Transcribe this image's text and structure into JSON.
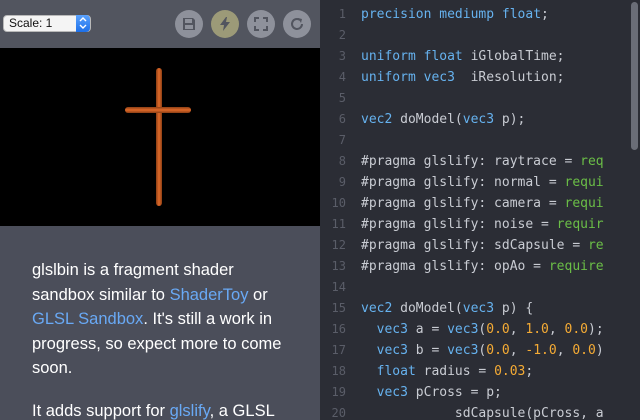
{
  "toolbar": {
    "scale_label": "Scale: 1",
    "buttons": [
      {
        "name": "save-icon"
      },
      {
        "name": "lightning-icon"
      },
      {
        "name": "fullscreen-icon"
      },
      {
        "name": "refresh-icon"
      }
    ]
  },
  "intro": {
    "p1": [
      {
        "text": "glslbin is a fragment shader sandbox similar to ",
        "link": false
      },
      {
        "text": "ShaderToy",
        "link": true
      },
      {
        "text": " or ",
        "link": false
      },
      {
        "text": "GLSL Sandbox",
        "link": true
      },
      {
        "text": ". It's still a work in progress, so expect more to come soon.",
        "link": false
      }
    ],
    "p2": [
      {
        "text": "It adds support for ",
        "link": false
      },
      {
        "text": "glslify",
        "link": true
      },
      {
        "text": ", a GLSL",
        "link": false
      }
    ]
  },
  "code": [
    {
      "n": "1",
      "parts": [
        [
          "kw",
          "precision"
        ],
        [
          "t",
          " "
        ],
        [
          "kw",
          "mediump"
        ],
        [
          "t",
          " "
        ],
        [
          "kw",
          "float"
        ],
        [
          "t",
          ";"
        ]
      ]
    },
    {
      "n": "2",
      "parts": []
    },
    {
      "n": "3",
      "parts": [
        [
          "kw",
          "uniform"
        ],
        [
          "t",
          " "
        ],
        [
          "kw",
          "float"
        ],
        [
          "t",
          " iGlobalTime;"
        ]
      ]
    },
    {
      "n": "4",
      "parts": [
        [
          "kw",
          "uniform"
        ],
        [
          "t",
          " "
        ],
        [
          "kw",
          "vec3"
        ],
        [
          "t",
          "  iResolution;"
        ]
      ]
    },
    {
      "n": "5",
      "parts": []
    },
    {
      "n": "6",
      "parts": [
        [
          "kw",
          "vec2"
        ],
        [
          "t",
          " doModel("
        ],
        [
          "kw",
          "vec3"
        ],
        [
          "t",
          " p);"
        ]
      ]
    },
    {
      "n": "7",
      "parts": []
    },
    {
      "n": "8",
      "parts": [
        [
          "t",
          "#pragma glslify: raytrace = "
        ],
        [
          "str",
          "req"
        ]
      ]
    },
    {
      "n": "9",
      "parts": [
        [
          "t",
          "#pragma glslify: normal = "
        ],
        [
          "str",
          "requi"
        ]
      ]
    },
    {
      "n": "10",
      "parts": [
        [
          "t",
          "#pragma glslify: camera = "
        ],
        [
          "str",
          "requi"
        ]
      ]
    },
    {
      "n": "11",
      "parts": [
        [
          "t",
          "#pragma glslify: noise = "
        ],
        [
          "str",
          "requir"
        ]
      ]
    },
    {
      "n": "12",
      "parts": [
        [
          "t",
          "#pragma glslify: sdCapsule = "
        ],
        [
          "str",
          "re"
        ]
      ]
    },
    {
      "n": "13",
      "parts": [
        [
          "t",
          "#pragma glslify: opAo = "
        ],
        [
          "str",
          "require"
        ]
      ]
    },
    {
      "n": "14",
      "parts": []
    },
    {
      "n": "15",
      "parts": [
        [
          "kw",
          "vec2"
        ],
        [
          "t",
          " doModel("
        ],
        [
          "kw",
          "vec3"
        ],
        [
          "t",
          " p) {"
        ]
      ]
    },
    {
      "n": "16",
      "parts": [
        [
          "t",
          "  "
        ],
        [
          "kw",
          "vec3"
        ],
        [
          "t",
          " a = "
        ],
        [
          "kw",
          "vec3"
        ],
        [
          "t",
          "("
        ],
        [
          "num",
          "0.0"
        ],
        [
          "t",
          ", "
        ],
        [
          "num",
          "1.0"
        ],
        [
          "t",
          ", "
        ],
        [
          "num",
          "0.0"
        ],
        [
          "t",
          ");"
        ]
      ]
    },
    {
      "n": "17",
      "parts": [
        [
          "t",
          "  "
        ],
        [
          "kw",
          "vec3"
        ],
        [
          "t",
          " b = "
        ],
        [
          "kw",
          "vec3"
        ],
        [
          "t",
          "("
        ],
        [
          "num",
          "0.0"
        ],
        [
          "t",
          ", "
        ],
        [
          "num",
          "-1.0"
        ],
        [
          "t",
          ", "
        ],
        [
          "num",
          "0.0"
        ],
        [
          "t",
          ")"
        ]
      ]
    },
    {
      "n": "18",
      "parts": [
        [
          "t",
          "  "
        ],
        [
          "kw",
          "float"
        ],
        [
          "t",
          " radius = "
        ],
        [
          "num",
          "0.03"
        ],
        [
          "t",
          ";"
        ]
      ]
    },
    {
      "n": "19",
      "parts": [
        [
          "t",
          "  "
        ],
        [
          "kw",
          "vec3"
        ],
        [
          "t",
          " pCross = p;"
        ]
      ]
    },
    {
      "n": "20",
      "parts": [
        [
          "t",
          "            sdCapsule(pCross, a"
        ]
      ]
    }
  ]
}
